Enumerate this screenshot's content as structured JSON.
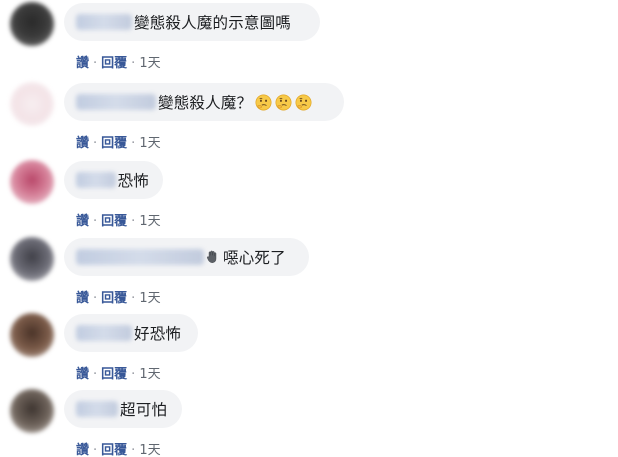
{
  "actions": {
    "like_label": "讚",
    "reply_label": "回覆",
    "separator": "·"
  },
  "comments": [
    {
      "text": "變態殺人魔的示意圖嗎",
      "time": "1天"
    },
    {
      "text": "變態殺人魔？",
      "time": "1天"
    },
    {
      "text": "恐怖",
      "time": "1天"
    },
    {
      "text": "噁心死了",
      "time": "1天"
    },
    {
      "text": "好恐怖",
      "time": "1天"
    },
    {
      "text": "超可怕",
      "time": "1天"
    }
  ],
  "icons": {
    "thinking_emoji": "thinking-face-emoji",
    "hand": "raised-hand-emoji"
  },
  "colors": {
    "bubble": "#f2f3f5",
    "action_link": "#385898",
    "time_text": "#606770"
  }
}
